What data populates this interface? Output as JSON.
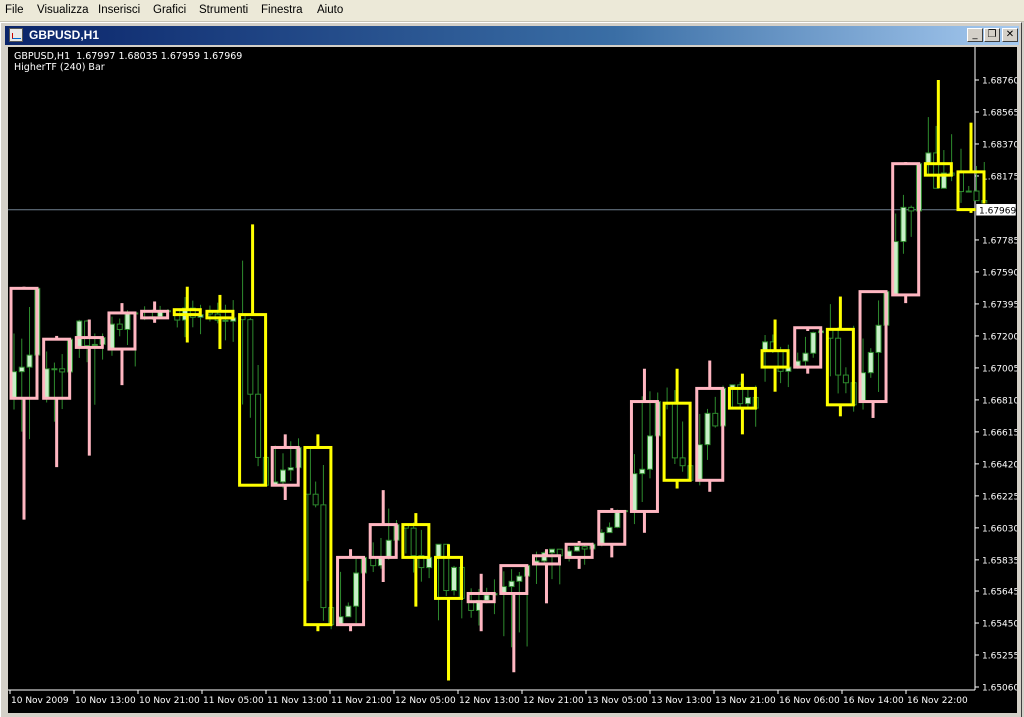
{
  "menu": {
    "items": [
      {
        "label": "File"
      },
      {
        "label": "Visualizza"
      },
      {
        "label": "Inserisci"
      },
      {
        "label": "Grafici"
      },
      {
        "label": "Strumenti"
      },
      {
        "label": "Finestra"
      },
      {
        "label": "Aiuto"
      }
    ]
  },
  "window": {
    "title": "GBPUSD,H1",
    "minimize_glyph": "_",
    "restore_glyph": "❐",
    "close_glyph": "✕"
  },
  "chart_info": {
    "header": "GBPUSD,H1  1.67997 1.68035 1.67959 1.67969",
    "indicator": "HigherTF (240) Bar"
  },
  "chart_data": {
    "type": "candlestick",
    "symbol": "GBPUSD",
    "timeframe": "H1",
    "ohlc_header": {
      "open": 1.67997,
      "high": 1.68035,
      "low": 1.67959,
      "close": 1.67969
    },
    "current_price": 1.67969,
    "current_price_label": "1.67969",
    "ylim": [
      1.6506,
      1.6876
    ],
    "y_ticks": [
      "1.68760",
      "1.68565",
      "1.68370",
      "1.68175",
      "1.67785",
      "1.67590",
      "1.67395",
      "1.67200",
      "1.67005",
      "1.66810",
      "1.66615",
      "1.66420",
      "1.66225",
      "1.66030",
      "1.65835",
      "1.65645",
      "1.65450",
      "1.65255",
      "1.65060"
    ],
    "x_ticks": [
      "10 Nov 2009",
      "10 Nov 13:00",
      "10 Nov 21:00",
      "11 Nov 05:00",
      "11 Nov 13:00",
      "11 Nov 21:00",
      "12 Nov 05:00",
      "12 Nov 13:00",
      "12 Nov 21:00",
      "13 Nov 05:00",
      "13 Nov 13:00",
      "13 Nov 21:00",
      "16 Nov 06:00",
      "16 Nov 14:00",
      "16 Nov 22:00"
    ],
    "colors": {
      "background": "#000000",
      "axis": "#ffffff",
      "bull_body": "#c8f0c8",
      "bear_body": "#000000",
      "candle_wick": "#2e8b2e",
      "higher_tf_bull": "#ffb6c1",
      "higher_tf_bear": "#ffff00",
      "price_line": "#708090"
    },
    "higher_tf_bars": [
      {
        "o": 1.6682,
        "h": 1.675,
        "l": 1.6608,
        "c": 1.6749
      },
      {
        "o": 1.6682,
        "h": 1.672,
        "l": 1.664,
        "c": 1.6718
      },
      {
        "o": 1.6713,
        "h": 1.673,
        "l": 1.6647,
        "c": 1.6719
      },
      {
        "o": 1.6712,
        "h": 1.674,
        "l": 1.669,
        "c": 1.6734
      },
      {
        "o": 1.6731,
        "h": 1.6741,
        "l": 1.6728,
        "c": 1.6735
      },
      {
        "o": 1.6736,
        "h": 1.675,
        "l": 1.6716,
        "c": 1.6733
      },
      {
        "o": 1.6735,
        "h": 1.6745,
        "l": 1.6712,
        "c": 1.6731
      },
      {
        "o": 1.6733,
        "h": 1.6788,
        "l": 1.6629,
        "c": 1.6629
      },
      {
        "o": 1.6629,
        "h": 1.666,
        "l": 1.662,
        "c": 1.6652
      },
      {
        "o": 1.6652,
        "h": 1.666,
        "l": 1.654,
        "c": 1.6544
      },
      {
        "o": 1.6544,
        "h": 1.659,
        "l": 1.654,
        "c": 1.6585
      },
      {
        "o": 1.6585,
        "h": 1.6626,
        "l": 1.657,
        "c": 1.6605
      },
      {
        "o": 1.6605,
        "h": 1.6612,
        "l": 1.6555,
        "c": 1.6585
      },
      {
        "o": 1.6585,
        "h": 1.6593,
        "l": 1.651,
        "c": 1.656
      },
      {
        "o": 1.6558,
        "h": 1.6575,
        "l": 1.654,
        "c": 1.6563
      },
      {
        "o": 1.6563,
        "h": 1.658,
        "l": 1.6515,
        "c": 1.658
      },
      {
        "o": 1.6581,
        "h": 1.659,
        "l": 1.6557,
        "c": 1.6586
      },
      {
        "o": 1.6585,
        "h": 1.6595,
        "l": 1.6578,
        "c": 1.6593
      },
      {
        "o": 1.6593,
        "h": 1.6615,
        "l": 1.6585,
        "c": 1.6613
      },
      {
        "o": 1.6613,
        "h": 1.67,
        "l": 1.66,
        "c": 1.668
      },
      {
        "o": 1.6679,
        "h": 1.67,
        "l": 1.6627,
        "c": 1.6632
      },
      {
        "o": 1.6632,
        "h": 1.6705,
        "l": 1.6625,
        "c": 1.6688
      },
      {
        "o": 1.6688,
        "h": 1.6697,
        "l": 1.666,
        "c": 1.6676
      },
      {
        "o": 1.6711,
        "h": 1.673,
        "l": 1.6686,
        "c": 1.6701
      },
      {
        "o": 1.6701,
        "h": 1.6723,
        "l": 1.6697,
        "c": 1.6725
      },
      {
        "o": 1.6724,
        "h": 1.6744,
        "l": 1.6671,
        "c": 1.6678
      },
      {
        "o": 1.668,
        "h": 1.6747,
        "l": 1.667,
        "c": 1.6747
      },
      {
        "o": 1.6745,
        "h": 1.6826,
        "l": 1.674,
        "c": 1.6825
      },
      {
        "o": 1.6825,
        "h": 1.6876,
        "l": 1.681,
        "c": 1.6818
      },
      {
        "o": 1.682,
        "h": 1.685,
        "l": 1.6795,
        "c": 1.6797
      }
    ]
  }
}
